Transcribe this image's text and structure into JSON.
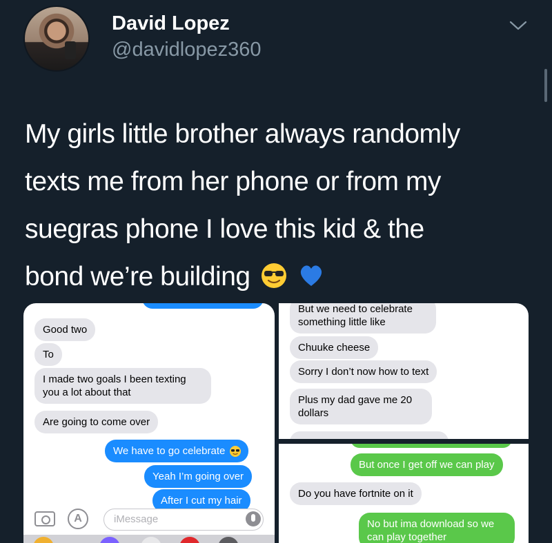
{
  "tweet": {
    "display_name": "David Lopez",
    "handle": "@davidlopez360",
    "text_lines": [
      "My girls little brother always randomly",
      "texts me from her phone or from my",
      "suegras phone I love this kid & the",
      "bond we’re building"
    ],
    "emojis": [
      "sunglasses-emoji",
      "blue-heart-emoji"
    ]
  },
  "screenshot_left": {
    "messages": [
      {
        "from": "them",
        "text": "Good two"
      },
      {
        "from": "them",
        "text": "To"
      },
      {
        "from": "them",
        "text": "I made two goals I been texting"
      },
      {
        "from": "them",
        "text": "you a lot about that"
      },
      {
        "from": "them",
        "text": "Are going to come over"
      },
      {
        "from": "me",
        "text": "We have to go celebrate"
      },
      {
        "from": "me",
        "text": "Yeah I’m going over"
      },
      {
        "from": "me",
        "text": "After I cut my hair"
      }
    ],
    "input_placeholder": "iMessage"
  },
  "screenshot_right_top": {
    "messages": [
      {
        "from": "them",
        "text": "But we need to celebrate"
      },
      {
        "from": "them",
        "text": "something little like"
      },
      {
        "from": "them",
        "text": "Chuuke cheese"
      },
      {
        "from": "them",
        "text": "Sorry I don’t now how to text"
      },
      {
        "from": "them",
        "text": "Plus my dad gave me 20"
      },
      {
        "from": "them",
        "text": "dollars"
      }
    ]
  },
  "screenshot_right_bottom": {
    "messages": [
      {
        "from": "me",
        "text": "But once I get off we can play"
      },
      {
        "from": "them",
        "text": "Do you have fortnite on it"
      },
      {
        "from": "me",
        "text": "No but ima download so we"
      },
      {
        "from": "me",
        "text": "can play together"
      }
    ]
  },
  "colors": {
    "background": "#15202b",
    "secondary_text": "#8899a6",
    "imessage_blue": "#1a8cff",
    "sms_green": "#5ac84a",
    "received_gray": "#e5e5ea"
  }
}
